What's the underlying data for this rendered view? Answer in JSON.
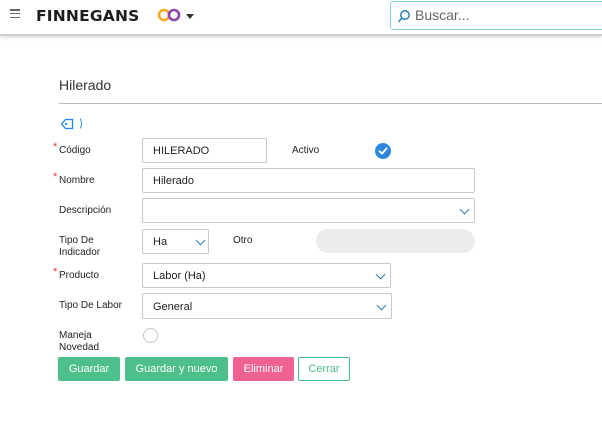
{
  "header": {
    "brand": "FINNEGANS",
    "search_placeholder": "Buscar..."
  },
  "page": {
    "title": "Hilerado"
  },
  "form": {
    "codigo": {
      "label": "Código",
      "value": "HILERADO"
    },
    "activo": {
      "label": "Activo",
      "checked": true
    },
    "nombre": {
      "label": "Nombre",
      "value": "Hilerado"
    },
    "descripcion": {
      "label": "Descripción",
      "value": ""
    },
    "tipo_indicador": {
      "label_line1": "Tipo De",
      "label_line2": "Indicador",
      "value": "Ha"
    },
    "otro": {
      "label": "Otro",
      "value": ""
    },
    "producto": {
      "label": "Producto",
      "value": "Labor (Ha)"
    },
    "tipo_labor": {
      "label": "Tipo De Labor",
      "value": "General"
    },
    "maneja_novedad": {
      "label_line1": "Maneja",
      "label_line2": "Novedad",
      "checked": false
    }
  },
  "buttons": {
    "guardar": "Guardar",
    "guardar_nuevo": "Guardar y nuevo",
    "eliminar": "Eliminar",
    "cerrar": "Cerrar"
  },
  "colors": {
    "accent_green": "#4cbf8a",
    "delete_pink": "#f06292",
    "check_blue": "#2e86de",
    "required_red": "#e53935"
  }
}
